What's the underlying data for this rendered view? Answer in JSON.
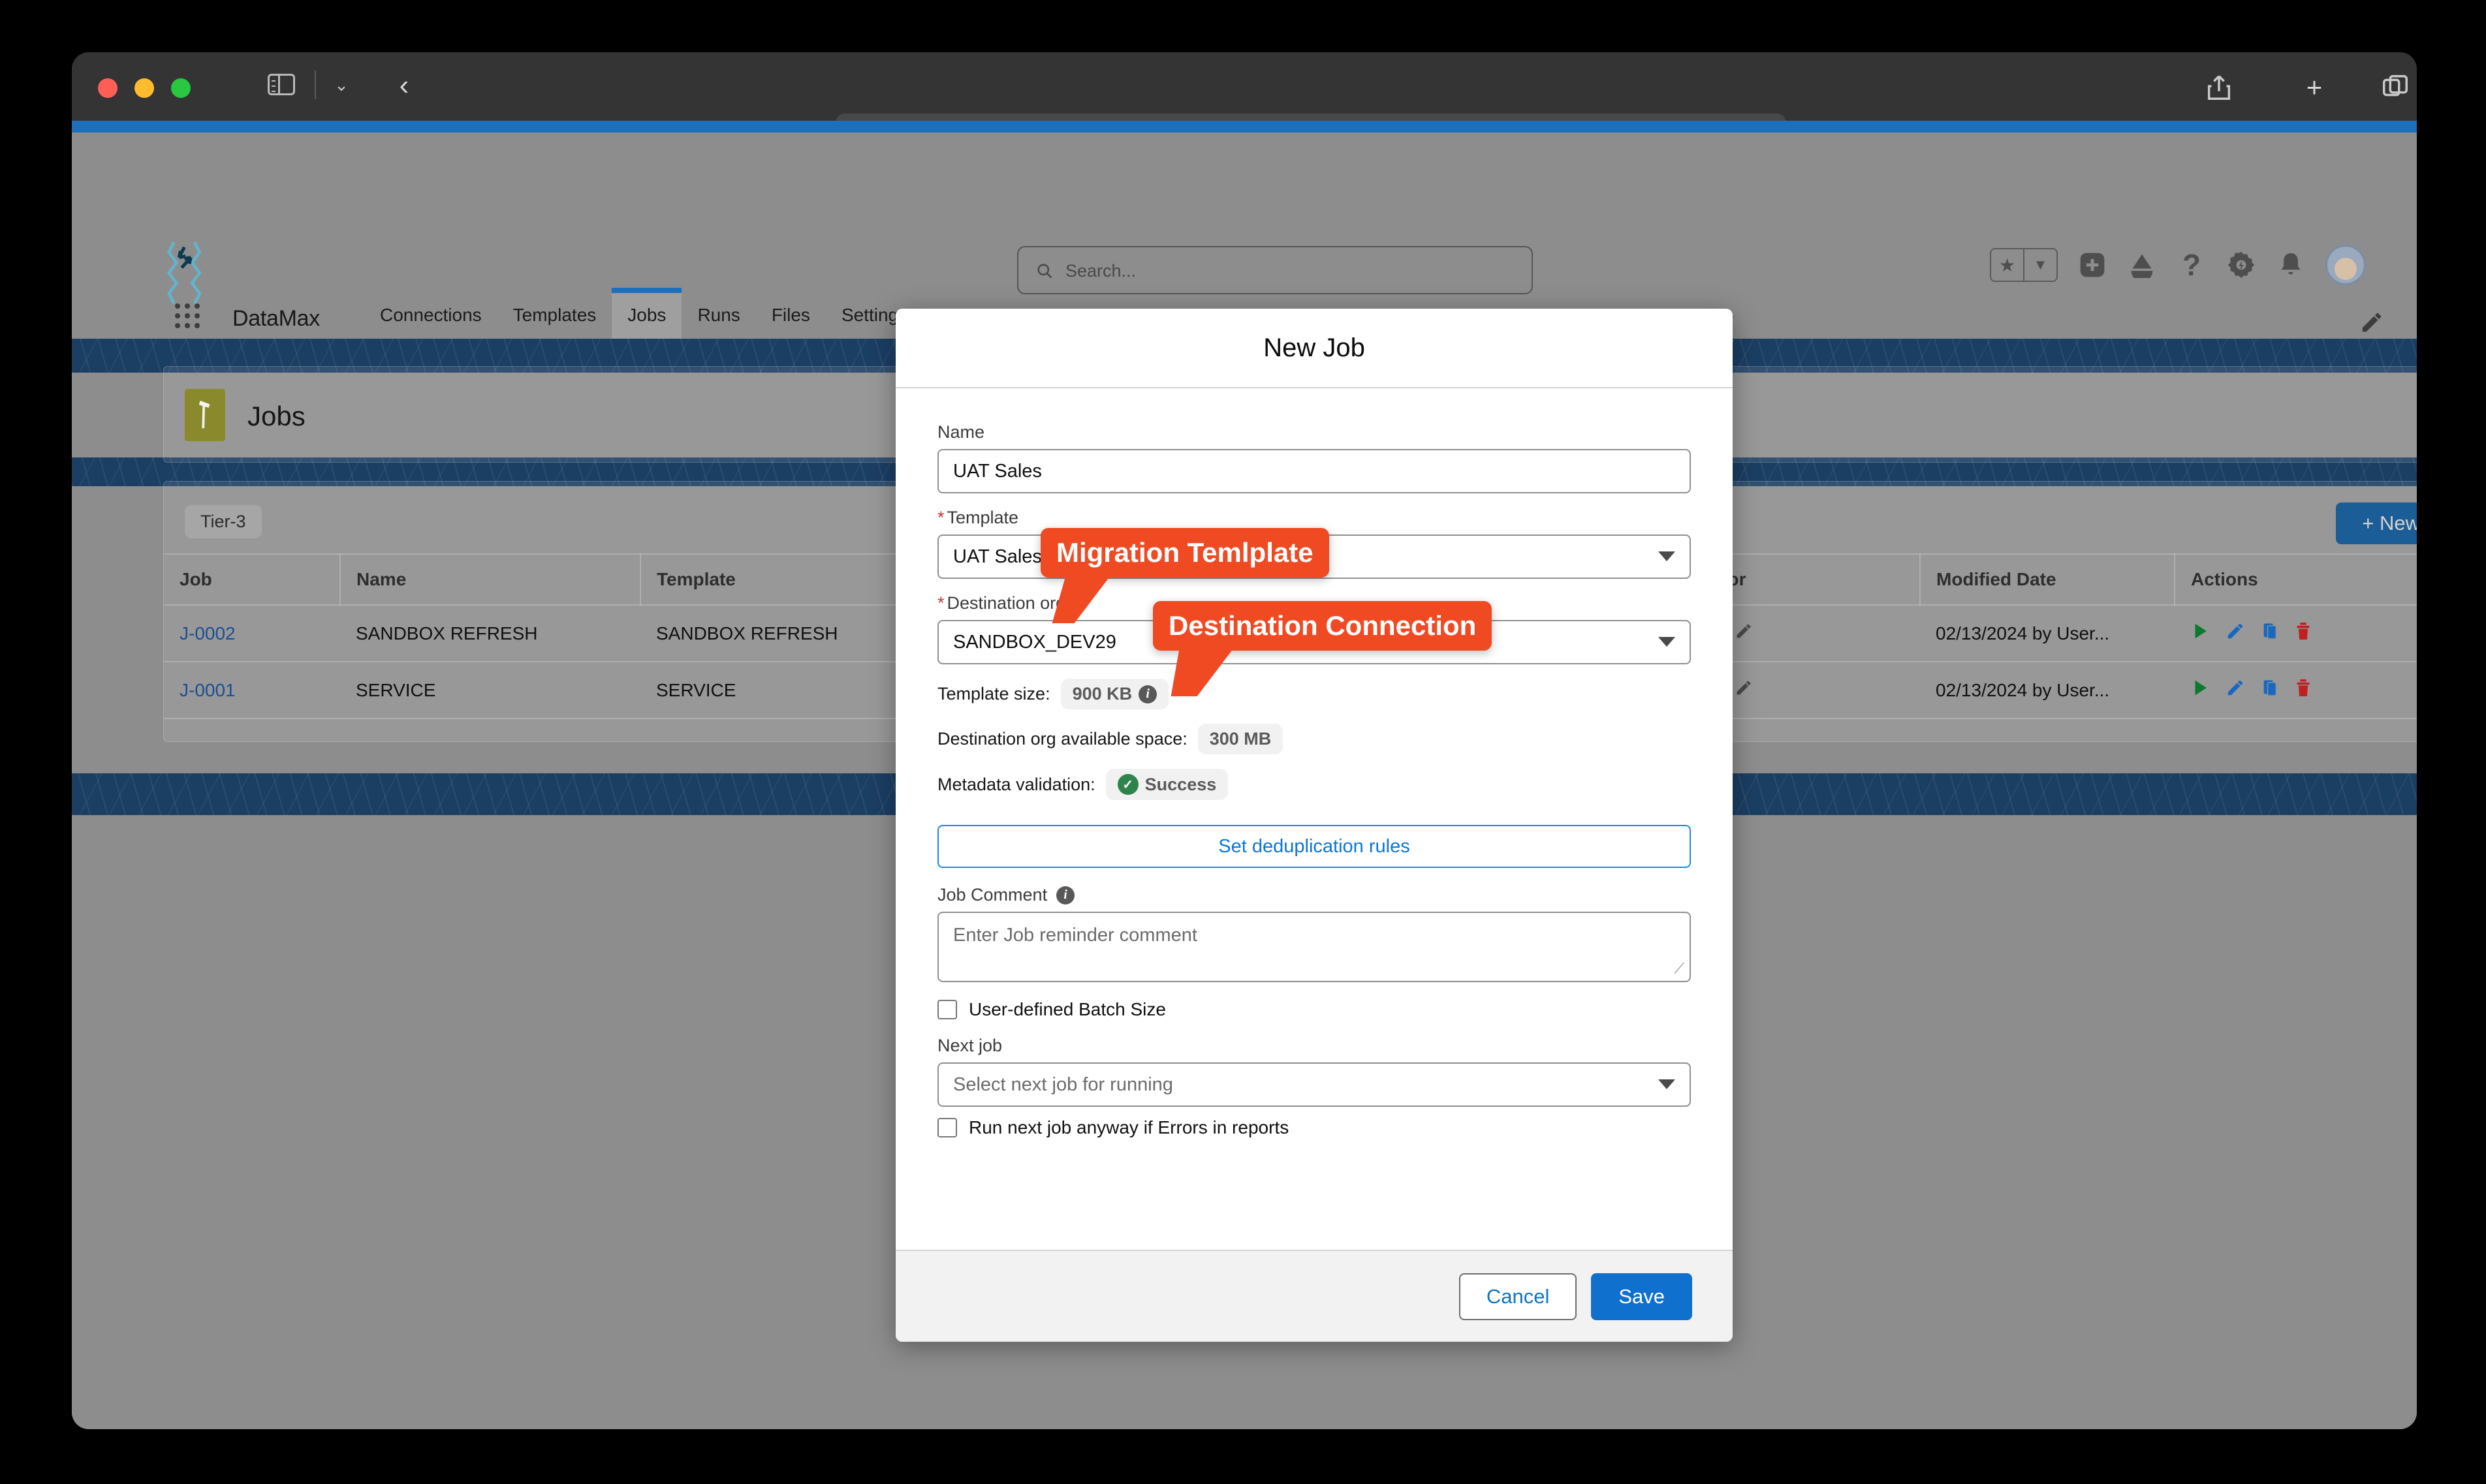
{
  "browser": {
    "url_value": "",
    "url_placeholder": "",
    "more_icon": "•••",
    "share_icon": "share-icon",
    "newtab_icon": "+",
    "tabs_icon": "tab-overview-icon",
    "back_icon": "‹"
  },
  "global_header": {
    "search_placeholder": "Search...",
    "icons": [
      {
        "name": "favorites-star",
        "glyph": "★"
      },
      {
        "name": "favorites-caret",
        "glyph": "▾"
      },
      {
        "name": "add-favorite",
        "glyph": "+"
      },
      {
        "name": "app-launcher-cloud",
        "glyph": "◬"
      },
      {
        "name": "help",
        "glyph": "?"
      },
      {
        "name": "setup-gear",
        "glyph": "⚙"
      },
      {
        "name": "notifications-bell",
        "glyph": "🔔"
      }
    ]
  },
  "app_nav": {
    "app_name": "DataMax",
    "items": [
      {
        "label": "Connections",
        "active": false
      },
      {
        "label": "Templates",
        "active": false
      },
      {
        "label": "Jobs",
        "active": true
      },
      {
        "label": "Runs",
        "active": false
      },
      {
        "label": "Files",
        "active": false
      },
      {
        "label": "Settings",
        "active": false
      }
    ]
  },
  "jobs_page": {
    "title": "Jobs",
    "tier_badge": "Tier-3",
    "new_button": "+ New",
    "columns": [
      "Job",
      "Name",
      "Template",
      "Error",
      "Modified Date",
      "Actions"
    ],
    "rows": [
      {
        "job": "J-0002",
        "name": "SANDBOX REFRESH",
        "template": "SANDBOX REFRESH",
        "error": "",
        "modified": "02/13/2024 by User...",
        "actions": [
          "run-icon",
          "edit-icon",
          "clone-icon",
          "delete-icon"
        ]
      },
      {
        "job": "J-0001",
        "name": "SERVICE",
        "template": "SERVICE",
        "error": "",
        "modified": "02/13/2024 by User...",
        "actions": [
          "run-icon",
          "edit-icon",
          "clone-icon",
          "delete-icon"
        ]
      }
    ]
  },
  "modal": {
    "title": "New Job",
    "name_label": "Name",
    "name_value": "UAT Sales",
    "template_label": "Template",
    "template_required": "*",
    "template_value": "UAT Sales Process",
    "destination_label": "Destination org",
    "destination_required": "*",
    "destination_value": "SANDBOX_DEV29",
    "template_size_label": "Template size:",
    "template_size_value": "900 KB",
    "available_space_label": "Destination org available space:",
    "available_space_value": "300 MB",
    "metadata_label": "Metadata validation:",
    "metadata_value": "Success",
    "dedup_button": "Set deduplication rules",
    "comment_label": "Job Comment",
    "comment_placeholder": "Enter Job reminder comment",
    "batch_checkbox": "User-defined Batch Size",
    "next_job_label": "Next job",
    "next_job_placeholder": "Select next job for running",
    "run_anyway_checkbox": "Run next job anyway if Errors in reports",
    "cancel_button": "Cancel",
    "save_button": "Save"
  },
  "annotations": [
    {
      "text": "Migration Temlplate"
    },
    {
      "text": "Destination Connection"
    }
  ],
  "colors": {
    "accent_blue": "#1070ce",
    "nav_blue": "#1c6fbb",
    "strip_blue": "#1b3e63",
    "callout_orange": "#f04a23",
    "success_green": "#2e844a",
    "jobs_icon_olive": "#8a8a2c",
    "danger_red": "#c23934"
  }
}
